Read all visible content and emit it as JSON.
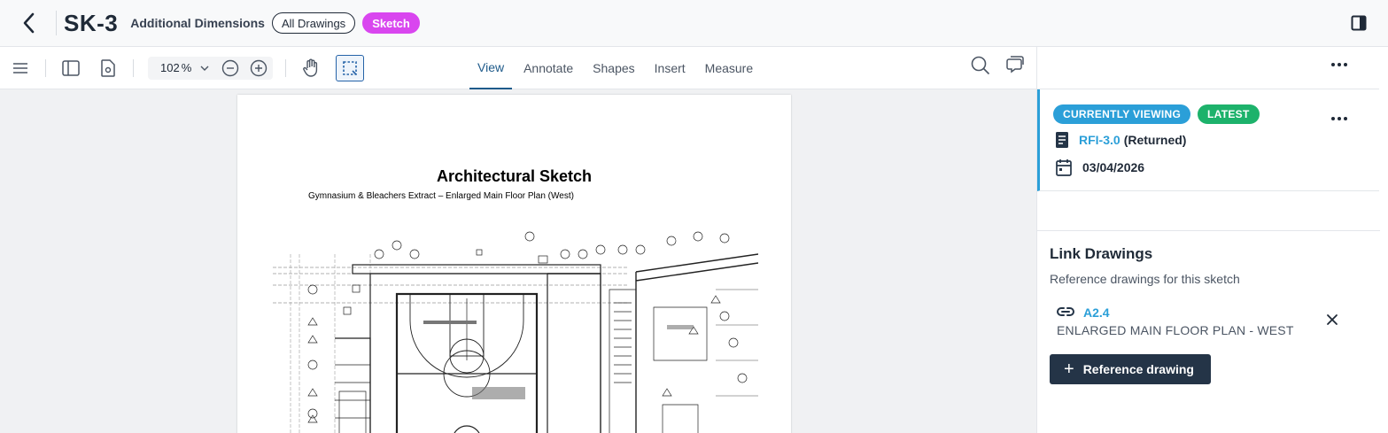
{
  "header": {
    "title": "SK-3",
    "subtitle": "Additional Dimensions",
    "all_drawings_label": "All Drawings",
    "sketch_label": "Sketch"
  },
  "toolbar": {
    "zoom_value": "102",
    "zoom_unit": "%",
    "tabs": [
      {
        "label": "View",
        "active": true
      },
      {
        "label": "Annotate",
        "active": false
      },
      {
        "label": "Shapes",
        "active": false
      },
      {
        "label": "Insert",
        "active": false
      },
      {
        "label": "Measure",
        "active": false
      }
    ]
  },
  "sheet": {
    "title": "Architectural Sketch",
    "subtitle": "Gymnasium & Bleachers Extract – Enlarged Main Floor Plan (West)"
  },
  "panel": {
    "currently_viewing_badge": "CURRENTLY VIEWING",
    "latest_badge": "LATEST",
    "rfi_link": "RFI-3.0",
    "rfi_status": "(Returned)",
    "date": "03/04/2026",
    "link_drawings_title": "Link Drawings",
    "link_drawings_desc": "Reference drawings for this sketch",
    "reference": {
      "code": "A2.4",
      "name": "ENLARGED MAIN FLOOR PLAN - WEST"
    },
    "reference_button_label": "Reference drawing"
  },
  "colors": {
    "accent_blue": "#2b9fd8",
    "sketch_magenta": "#d946ef",
    "latest_green": "#1db26b",
    "dark_button": "#243447"
  }
}
